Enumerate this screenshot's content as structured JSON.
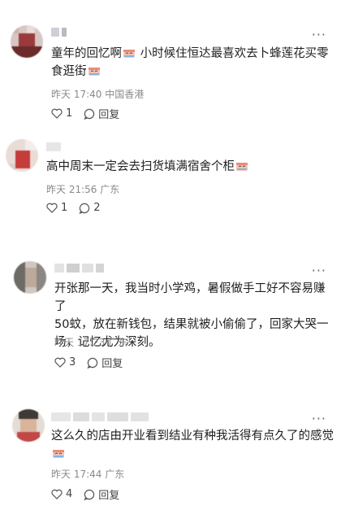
{
  "comments": [
    {
      "text_line1": "童年的回忆啊",
      "text_line1b": " 小时候住恒达最喜欢去卜蜂莲花买零",
      "text_line2": "食逛街",
      "time": "昨天 17:40",
      "location": "中国香港",
      "likes": "1",
      "reply_label": "回复"
    },
    {
      "text_line1": "高中周末一定会去扫货填满宿舍个柜",
      "time": "昨天 21:56",
      "location": "广东",
      "likes": "1",
      "replies": "2"
    },
    {
      "text_line1": "开张那一天，我当时小学鸡，暑假做手工好不容易赚了",
      "text_line2": "50蚊，放在新钱包，结果就被小偷偷了，回家大哭一",
      "text_line3": "场，记忆尤为深刻。",
      "time": "昨天 17:23",
      "location": "广东",
      "likes": "3",
      "reply_label": "回复"
    },
    {
      "text_line1": "这么久的店由开业看到结业有种我活得有点久了的感觉",
      "time": "昨天 17:44",
      "location": "广东",
      "likes": "4",
      "reply_label": "回复"
    }
  ],
  "more_icon": "ellipsis-icon",
  "like_icon": "heart-icon",
  "reply_icon": "speech-bubble-icon",
  "emoji_icon": "laughing-crying-emoji-icon"
}
